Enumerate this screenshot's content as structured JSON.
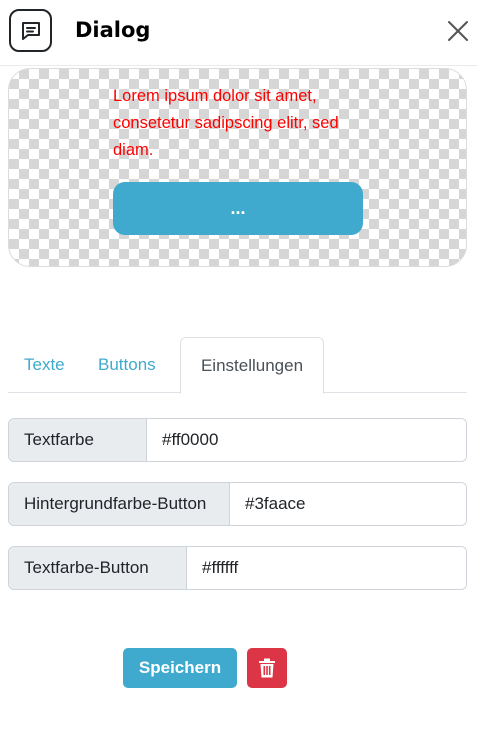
{
  "header": {
    "title": "Dialog",
    "icon": "message-square-icon",
    "close_icon": "close-icon"
  },
  "preview": {
    "text": "Lorem ipsum dolor sit amet, consetetur sadipscing elitr, sed diam.",
    "button_label": "...",
    "text_color": "#ff0000",
    "button_bg": "#3faace",
    "button_text_color": "#ffffff"
  },
  "tabs": [
    {
      "label": "Texte",
      "active": false
    },
    {
      "label": "Buttons",
      "active": false
    },
    {
      "label": "Einstellungen",
      "active": true
    }
  ],
  "settings": [
    {
      "label": "Textfarbe",
      "value": "#ff0000"
    },
    {
      "label": "Hintergrundfarbe-Button",
      "value": "#3faace"
    },
    {
      "label": "Textfarbe-Button",
      "value": "#ffffff"
    }
  ],
  "footer": {
    "save_label": "Speichern",
    "delete_icon": "trash-icon"
  },
  "colors": {
    "accent": "#3faace",
    "danger": "#dc3545"
  }
}
